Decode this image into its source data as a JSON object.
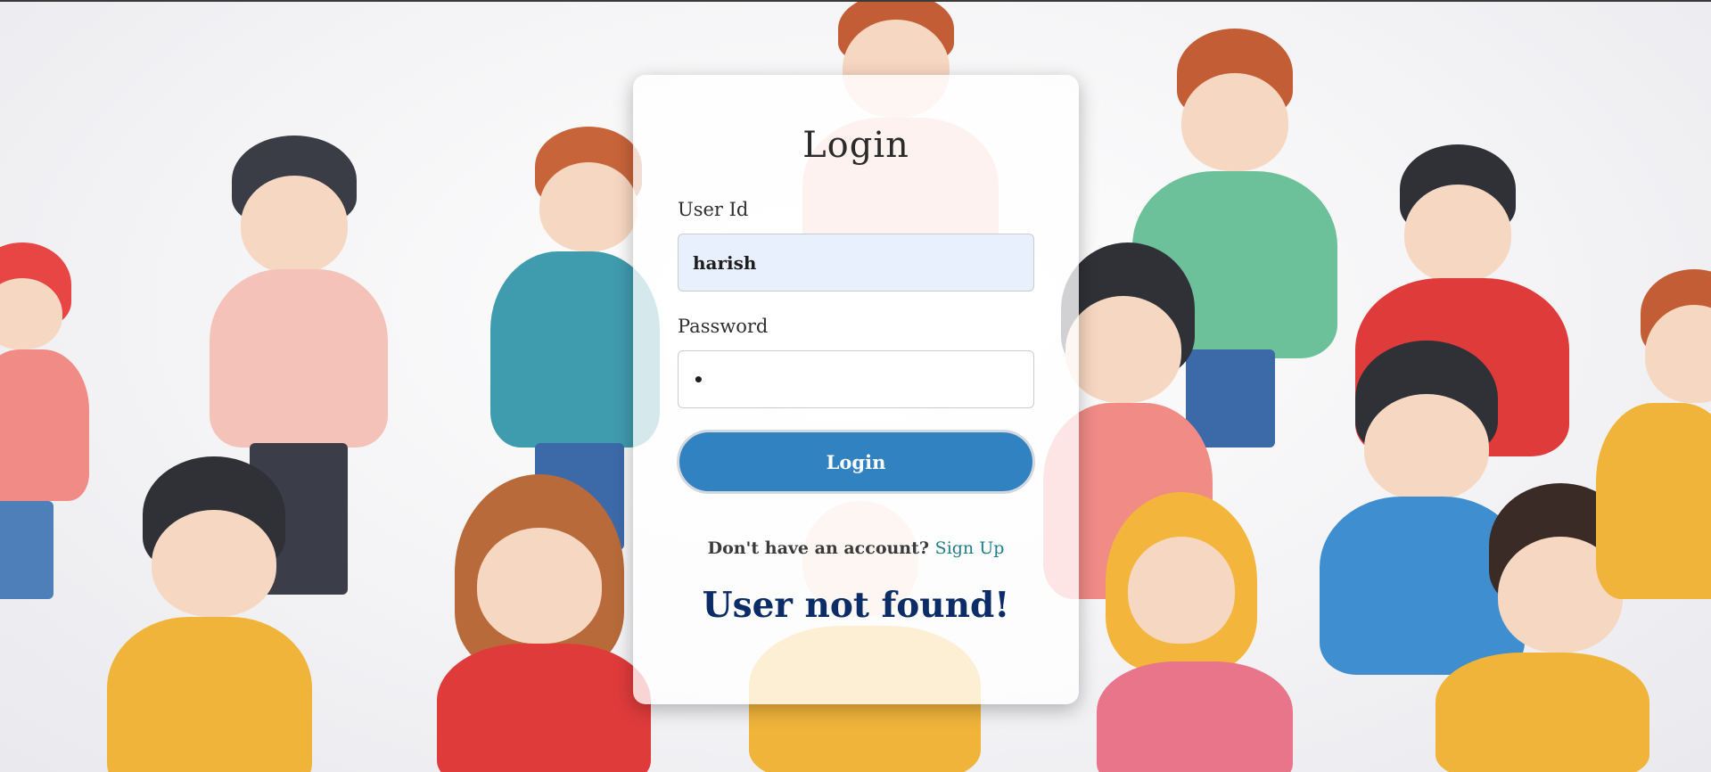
{
  "login": {
    "title": "Login",
    "user_id_label": "User Id",
    "user_id_value": "harish",
    "password_label": "Password",
    "password_value": "•",
    "submit_label": "Login",
    "signup_prompt": "Don't have an account?",
    "signup_link": "Sign Up",
    "error_message": "User not found!"
  },
  "colors": {
    "button": "#3182c0",
    "error_text": "#0b2c66",
    "link": "#1f7d86",
    "autofill_bg": "#e8f0fe"
  }
}
